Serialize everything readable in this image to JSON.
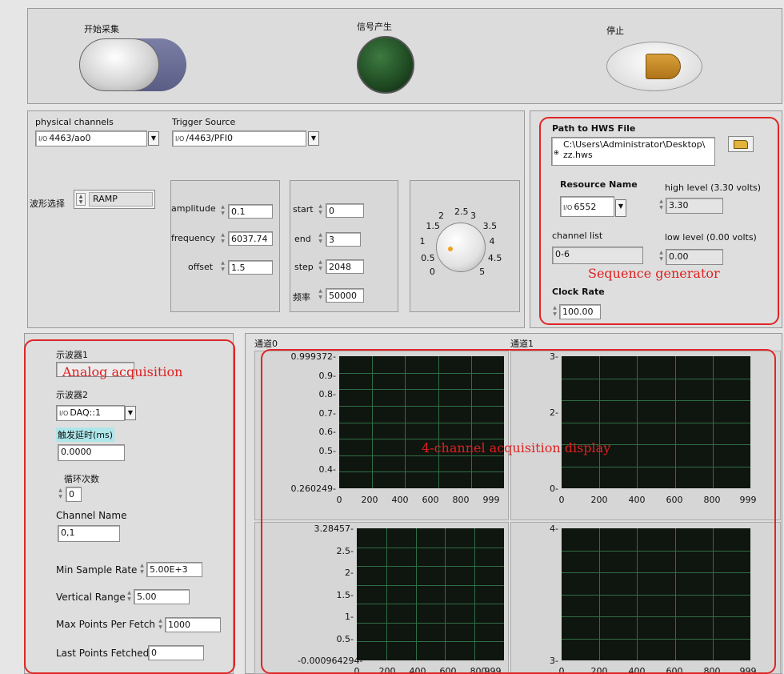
{
  "top": {
    "start_label": "开始采集",
    "signal_label": "信号产生",
    "stop_label": "停止"
  },
  "waveform": {
    "physical_channels_label": "physical channels",
    "physical_channels_value": "4463/ao0",
    "trigger_source_label": "Trigger Source",
    "trigger_source_value": "/4463/PFI0",
    "select_label": "波形选择",
    "select_value": "RAMP",
    "amplitude_label": "amplitude",
    "amplitude_value": "0.1",
    "frequency_label": "frequency",
    "frequency_value": "6037.74",
    "offset_label": "offset",
    "offset_value": "1.5",
    "start_label": "start",
    "start_value": "0",
    "end_label": "end",
    "end_value": "3",
    "step_label": "step",
    "step_value": "2048",
    "rate_label": "频率",
    "rate_value": "50000",
    "knob_ticks": [
      "0",
      "0.5",
      "1",
      "1.5",
      "2",
      "2.5",
      "3",
      "3.5",
      "4",
      "4.5",
      "5"
    ]
  },
  "sequence": {
    "path_label": "Path to HWS File",
    "path_value_1": "C:\\Users\\Administrator\\Desktop\\",
    "path_value_2": "zz.hws",
    "resource_label": "Resource Name",
    "resource_value": "6552",
    "high_label": "high level (3.30 volts)",
    "high_value": "3.30",
    "channel_list_label": "channel list",
    "channel_list_value": "0-6",
    "low_label": "low level (0.00 volts)",
    "low_value": "0.00",
    "clock_label": "Clock Rate",
    "clock_value": "100.00",
    "annotation": "Sequence generator"
  },
  "acquisition": {
    "scope1_label": "示波器1",
    "scope2_label": "示波器2",
    "scope2_value": "DAQ::1",
    "delay_label": "触发延时(ms)",
    "delay_value": "0.0000",
    "loop_label": "循环次数",
    "loop_value": "0",
    "channel_name_label": "Channel Name",
    "channel_name_value": "0,1",
    "min_rate_label": "Min Sample Rate",
    "min_rate_value": "5.00E+3",
    "vrange_label": "Vertical Range",
    "vrange_value": "5.00",
    "max_points_label": "Max Points Per Fetch",
    "max_points_value": "1000",
    "last_points_label": "Last Points Fetched",
    "last_points_value": "0",
    "annotation": "Analog acquisition"
  },
  "display": {
    "ch0_label": "通道0",
    "ch1_label": "通道1",
    "annotation": "4-channel acquisition display",
    "x_ticks": [
      "0",
      "200",
      "400",
      "600",
      "800",
      "999"
    ],
    "graph1_y": [
      "0.999372",
      "0.9",
      "0.8",
      "0.7",
      "0.6",
      "0.5",
      "0.4",
      "0.260249"
    ],
    "graph2_y": [
      "3",
      "2",
      "0"
    ],
    "graph3_y": [
      "3.28457",
      "2.5",
      "2",
      "1.5",
      "1",
      "0.5",
      "-0.000964294"
    ],
    "graph4_y": [
      "4",
      "3"
    ]
  },
  "colors": {
    "annotation_red": "#e02525",
    "graph_bg": "#0f150f",
    "grid": "#2f6e46",
    "led": "#1f4a22"
  }
}
